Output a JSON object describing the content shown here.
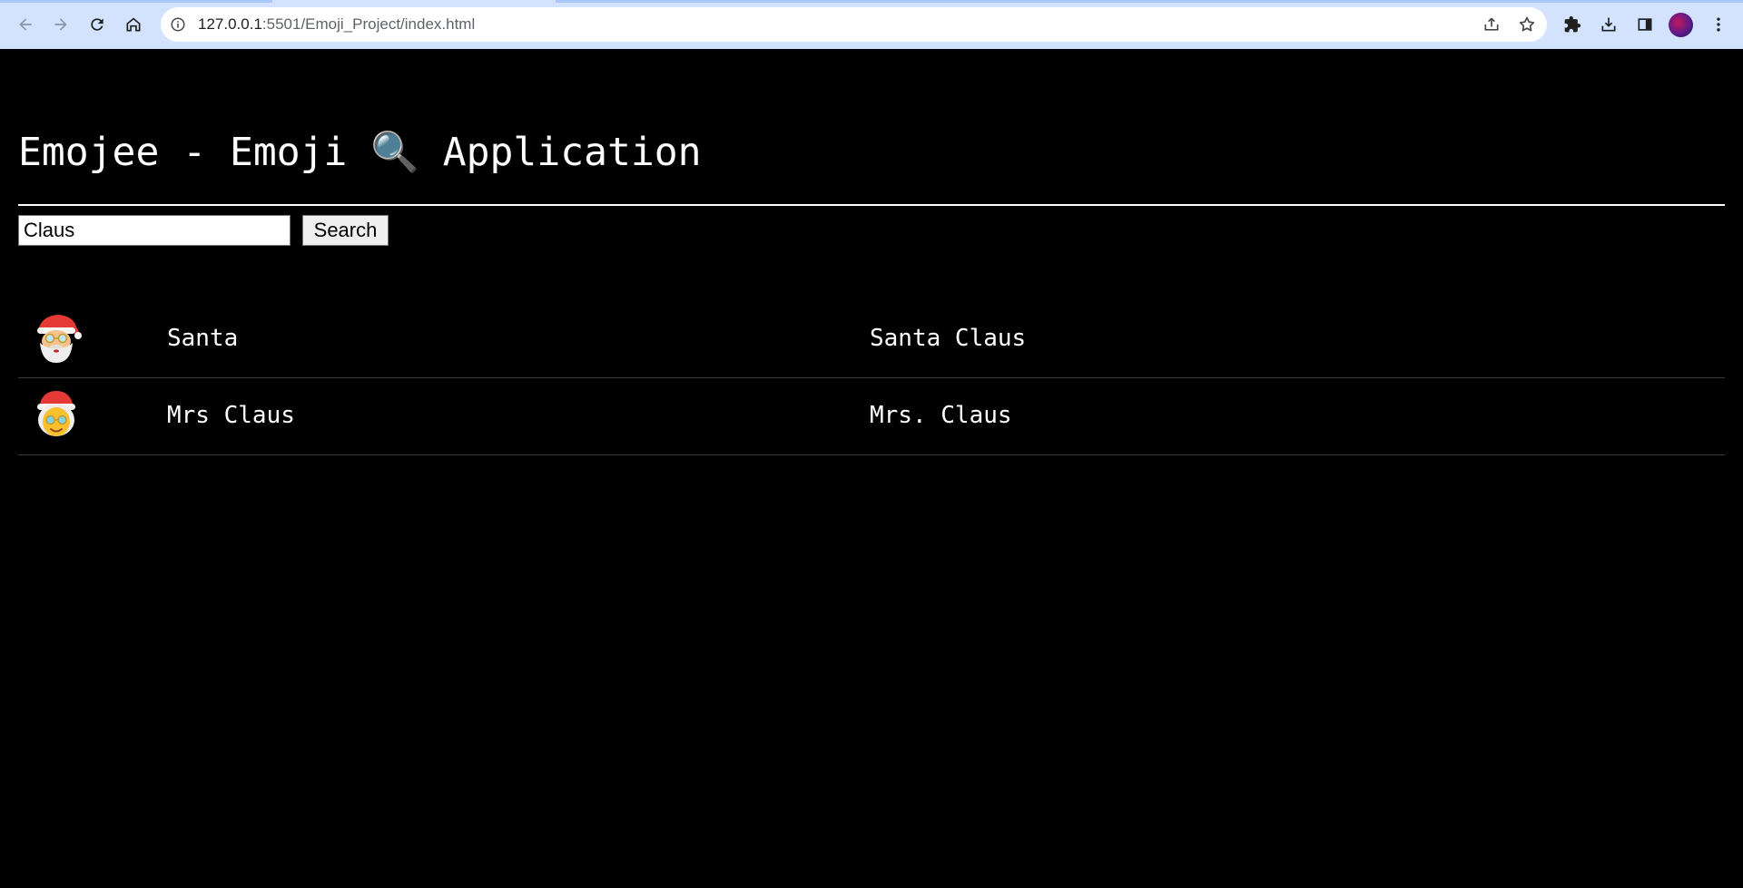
{
  "browser": {
    "url_host": "127.0.0.1",
    "url_path": ":5501/Emoji_Project/index.html",
    "icons": {
      "back": "arrow-left-icon",
      "forward": "arrow-right-icon",
      "reload": "reload-icon",
      "home": "home-icon",
      "site_info": "info-icon",
      "share": "share-icon",
      "bookmark": "star-icon",
      "extensions": "puzzle-icon",
      "downloads": "download-icon",
      "side_panel": "side-panel-icon",
      "menu": "kebab-menu-icon"
    },
    "colors": {
      "chrome_bg": "#d3e3fd",
      "omnibox_bg": "#ffffff"
    }
  },
  "page": {
    "title_prefix": "Emojee - Emoji",
    "title_emoji": "🔍",
    "title_suffix": "Application",
    "background": "#000000",
    "text_color": "#ffffff"
  },
  "search": {
    "value": "Claus",
    "button_label": "Search"
  },
  "results": [
    {
      "emoji": "santa-claus",
      "short_name": "Santa",
      "full_name": "Santa Claus"
    },
    {
      "emoji": "mrs-claus",
      "short_name": "Mrs Claus",
      "full_name": "Mrs. Claus"
    }
  ]
}
